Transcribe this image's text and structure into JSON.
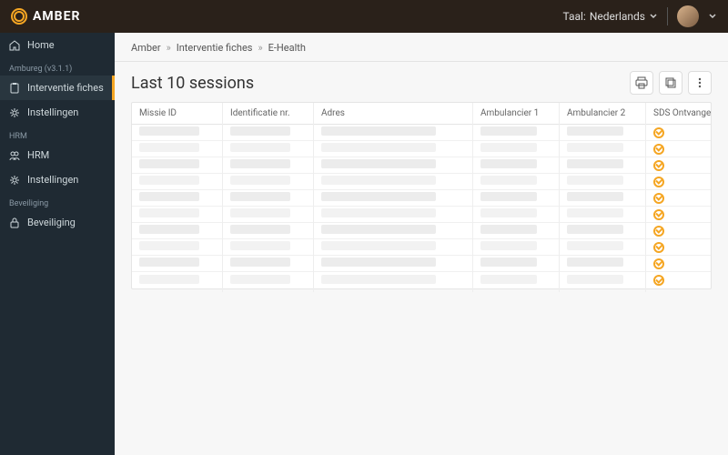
{
  "brand": {
    "name": "AMBER"
  },
  "topbar": {
    "lang_label": "Taal:",
    "lang_value": "Nederlands"
  },
  "sidebar": {
    "home": "Home",
    "sections": [
      {
        "title": "Ambureg (v3.1.1)",
        "items": [
          {
            "key": "interventie",
            "label": "Interventie fiches",
            "icon": "clipboard-icon",
            "active": true
          },
          {
            "key": "instellingen1",
            "label": "Instellingen",
            "icon": "gear-icon",
            "active": false
          }
        ]
      },
      {
        "title": "HRM",
        "items": [
          {
            "key": "hrm",
            "label": "HRM",
            "icon": "people-icon",
            "active": false
          },
          {
            "key": "instellingen2",
            "label": "Instellingen",
            "icon": "gear-icon",
            "active": false
          }
        ]
      },
      {
        "title": "Beveiliging",
        "items": [
          {
            "key": "beveiliging",
            "label": "Beveiliging",
            "icon": "lock-icon",
            "active": false
          }
        ]
      }
    ]
  },
  "breadcrumb": {
    "items": [
      "Amber",
      "Interventie fiches",
      "E-Health"
    ]
  },
  "page": {
    "title": "Last 10 sessions"
  },
  "table": {
    "columns": [
      "Missie ID",
      "Identificatie nr.",
      "Adres",
      "Ambulancier 1",
      "Ambulancier 2",
      "SDS Ontvangen"
    ],
    "row_count": 10,
    "status_label": "received"
  }
}
